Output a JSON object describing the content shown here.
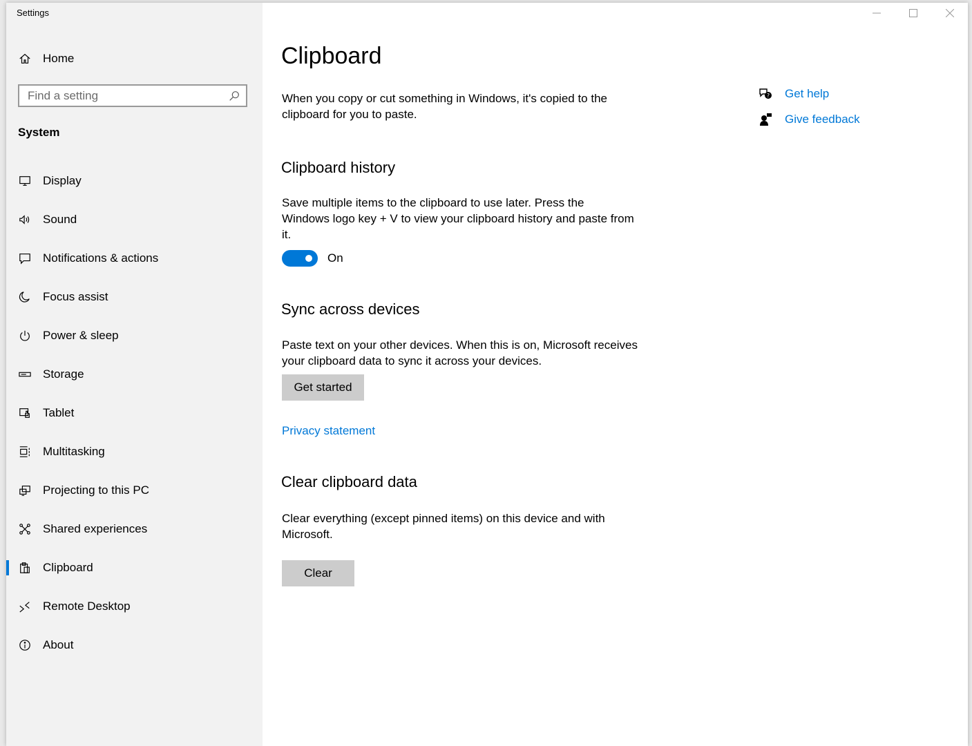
{
  "window": {
    "app_title": "Settings",
    "controls": {
      "minimize": "minimize",
      "maximize": "maximize",
      "close": "close"
    }
  },
  "sidebar": {
    "home_label": "Home",
    "search_placeholder": "Find a setting",
    "group_title": "System",
    "items": [
      {
        "label": "Display",
        "icon": "display-icon"
      },
      {
        "label": "Sound",
        "icon": "sound-icon"
      },
      {
        "label": "Notifications & actions",
        "icon": "notifications-icon"
      },
      {
        "label": "Focus assist",
        "icon": "moon-icon"
      },
      {
        "label": "Power & sleep",
        "icon": "power-icon"
      },
      {
        "label": "Storage",
        "icon": "storage-icon"
      },
      {
        "label": "Tablet",
        "icon": "tablet-icon"
      },
      {
        "label": "Multitasking",
        "icon": "multitasking-icon"
      },
      {
        "label": "Projecting to this PC",
        "icon": "projecting-icon"
      },
      {
        "label": "Shared experiences",
        "icon": "shared-icon"
      },
      {
        "label": "Clipboard",
        "icon": "clipboard-icon",
        "selected": true
      },
      {
        "label": "Remote Desktop",
        "icon": "remote-desktop-icon"
      },
      {
        "label": "About",
        "icon": "info-icon"
      }
    ]
  },
  "main": {
    "title": "Clipboard",
    "intro": "When you copy or cut something in Windows, it's copied to the clipboard for you to paste.",
    "history": {
      "title": "Clipboard history",
      "description": "Save multiple items to the clipboard to use later. Press the Windows logo key + V to view your clipboard history and paste from it.",
      "toggle_state": "On"
    },
    "sync": {
      "title": "Sync across devices",
      "description": "Paste text on your other devices. When this is on, Microsoft receives your clipboard data to sync it across your devices.",
      "button_label": "Get started",
      "privacy_link": "Privacy statement"
    },
    "clear": {
      "title": "Clear clipboard data",
      "description": "Clear everything (except pinned items) on this device and with Microsoft.",
      "button_label": "Clear"
    },
    "help": {
      "get_help": "Get help",
      "give_feedback": "Give feedback"
    }
  },
  "colors": {
    "accent": "#0078d7",
    "sidebar_bg": "#f2f2f2",
    "button_bg": "#cccccc"
  }
}
